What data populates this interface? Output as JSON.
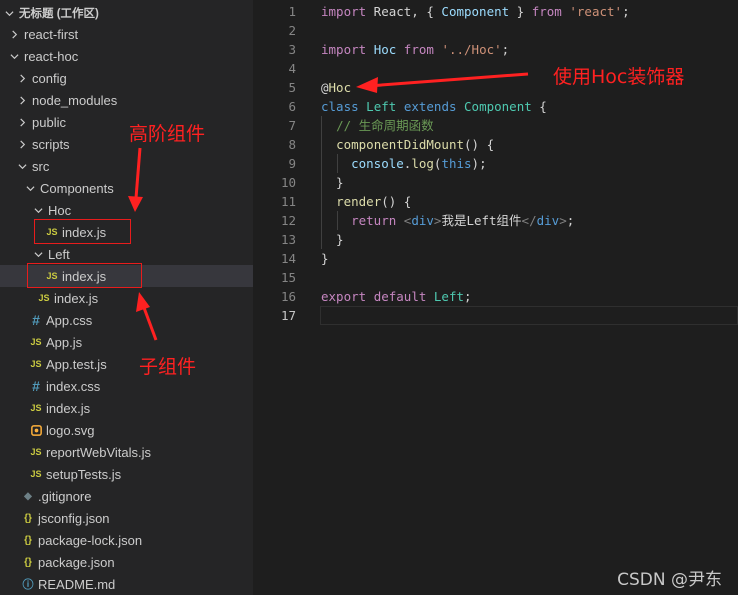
{
  "explorer": {
    "workspace_title": "无标题 (工作区)",
    "items": [
      {
        "label": "react-first",
        "type": "folder",
        "expanded": false,
        "depth": 1
      },
      {
        "label": "react-hoc",
        "type": "folder",
        "expanded": true,
        "depth": 1
      },
      {
        "label": "config",
        "type": "folder",
        "expanded": false,
        "depth": 2
      },
      {
        "label": "node_modules",
        "type": "folder",
        "expanded": false,
        "depth": 2
      },
      {
        "label": "public",
        "type": "folder",
        "expanded": false,
        "depth": 2
      },
      {
        "label": "scripts",
        "type": "folder",
        "expanded": false,
        "depth": 2
      },
      {
        "label": "src",
        "type": "folder",
        "expanded": true,
        "depth": 2
      },
      {
        "label": "Components",
        "type": "folder",
        "expanded": true,
        "depth": 3
      },
      {
        "label": "Hoc",
        "type": "folder",
        "expanded": true,
        "depth": 4
      },
      {
        "label": "index.js",
        "type": "js",
        "depth": 5
      },
      {
        "label": "Left",
        "type": "folder",
        "expanded": true,
        "depth": 4
      },
      {
        "label": "index.js",
        "type": "js",
        "depth": 5,
        "selected": true
      },
      {
        "label": "index.js",
        "type": "js",
        "depth": 4
      },
      {
        "label": "App.css",
        "type": "css",
        "depth": 3
      },
      {
        "label": "App.js",
        "type": "js",
        "depth": 3
      },
      {
        "label": "App.test.js",
        "type": "js",
        "depth": 3
      },
      {
        "label": "index.css",
        "type": "css",
        "depth": 3
      },
      {
        "label": "index.js",
        "type": "js",
        "depth": 3
      },
      {
        "label": "logo.svg",
        "type": "svg",
        "depth": 3
      },
      {
        "label": "reportWebVitals.js",
        "type": "js",
        "depth": 3
      },
      {
        "label": "setupTests.js",
        "type": "js",
        "depth": 3
      },
      {
        "label": ".gitignore",
        "type": "git",
        "depth": 2
      },
      {
        "label": "jsconfig.json",
        "type": "json",
        "depth": 2
      },
      {
        "label": "package-lock.json",
        "type": "json",
        "depth": 2
      },
      {
        "label": "package.json",
        "type": "json",
        "depth": 2
      },
      {
        "label": "README.md",
        "type": "info",
        "depth": 2
      }
    ],
    "icons": {
      "js": "JS",
      "css": "#",
      "json": "{}",
      "git": "◆",
      "info": "ⓘ"
    }
  },
  "editor": {
    "active_line": 17,
    "lines": [
      {
        "n": 1,
        "tokens": [
          [
            "kwc",
            "import"
          ],
          [
            "pn",
            " React, { "
          ],
          [
            "var",
            "Component"
          ],
          [
            "pn",
            " } "
          ],
          [
            "kwc",
            "from"
          ],
          [
            "pn",
            " "
          ],
          [
            "str",
            "'react'"
          ],
          [
            "pn",
            ";"
          ]
        ]
      },
      {
        "n": 2,
        "tokens": []
      },
      {
        "n": 3,
        "tokens": [
          [
            "kwc",
            "import"
          ],
          [
            "pn",
            " "
          ],
          [
            "var",
            "Hoc"
          ],
          [
            "pn",
            " "
          ],
          [
            "kwc",
            "from"
          ],
          [
            "pn",
            " "
          ],
          [
            "str",
            "'../Hoc'"
          ],
          [
            "pn",
            ";"
          ]
        ]
      },
      {
        "n": 4,
        "tokens": []
      },
      {
        "n": 5,
        "tokens": [
          [
            "pn",
            "@"
          ],
          [
            "fn",
            "Hoc"
          ]
        ]
      },
      {
        "n": 6,
        "tokens": [
          [
            "kw",
            "class"
          ],
          [
            "pn",
            " "
          ],
          [
            "cls",
            "Left"
          ],
          [
            "pn",
            " "
          ],
          [
            "kw",
            "extends"
          ],
          [
            "pn",
            " "
          ],
          [
            "cls",
            "Component"
          ],
          [
            "pn",
            " {"
          ]
        ]
      },
      {
        "n": 7,
        "tokens": [
          [
            "pn",
            "  "
          ],
          [
            "cm",
            "// 生命周期函数"
          ]
        ]
      },
      {
        "n": 8,
        "tokens": [
          [
            "pn",
            "  "
          ],
          [
            "fn",
            "componentDidMount"
          ],
          [
            "pn",
            "() {"
          ]
        ]
      },
      {
        "n": 9,
        "tokens": [
          [
            "pn",
            "    "
          ],
          [
            "var",
            "console"
          ],
          [
            "pn",
            "."
          ],
          [
            "fn",
            "log"
          ],
          [
            "pn",
            "("
          ],
          [
            "kw",
            "this"
          ],
          [
            "pn",
            ");"
          ]
        ]
      },
      {
        "n": 10,
        "tokens": [
          [
            "pn",
            "  }"
          ]
        ]
      },
      {
        "n": 11,
        "tokens": [
          [
            "pn",
            "  "
          ],
          [
            "fn",
            "render"
          ],
          [
            "pn",
            "() {"
          ]
        ]
      },
      {
        "n": 12,
        "tokens": [
          [
            "pn",
            "    "
          ],
          [
            "kwc",
            "return"
          ],
          [
            "pn",
            " "
          ],
          [
            "brk",
            "<"
          ],
          [
            "tag",
            "div"
          ],
          [
            "brk",
            ">"
          ],
          [
            "pn",
            "我是Left组件"
          ],
          [
            "brk",
            "</"
          ],
          [
            "tag",
            "div"
          ],
          [
            "brk",
            ">"
          ],
          [
            "pn",
            ";"
          ]
        ]
      },
      {
        "n": 13,
        "tokens": [
          [
            "pn",
            "  }"
          ]
        ]
      },
      {
        "n": 14,
        "tokens": [
          [
            "pn",
            "}"
          ]
        ]
      },
      {
        "n": 15,
        "tokens": []
      },
      {
        "n": 16,
        "tokens": [
          [
            "kwc",
            "export"
          ],
          [
            "pn",
            " "
          ],
          [
            "kwc",
            "default"
          ],
          [
            "pn",
            " "
          ],
          [
            "cls",
            "Left"
          ],
          [
            "pn",
            ";"
          ]
        ]
      },
      {
        "n": 17,
        "tokens": []
      }
    ]
  },
  "annotations": {
    "hoc_decorator": "使用Hoc装饰器",
    "hoc_component": "高阶组件",
    "child_component": "子组件",
    "color": "#ff2121"
  },
  "watermark": "CSDN @尹东"
}
